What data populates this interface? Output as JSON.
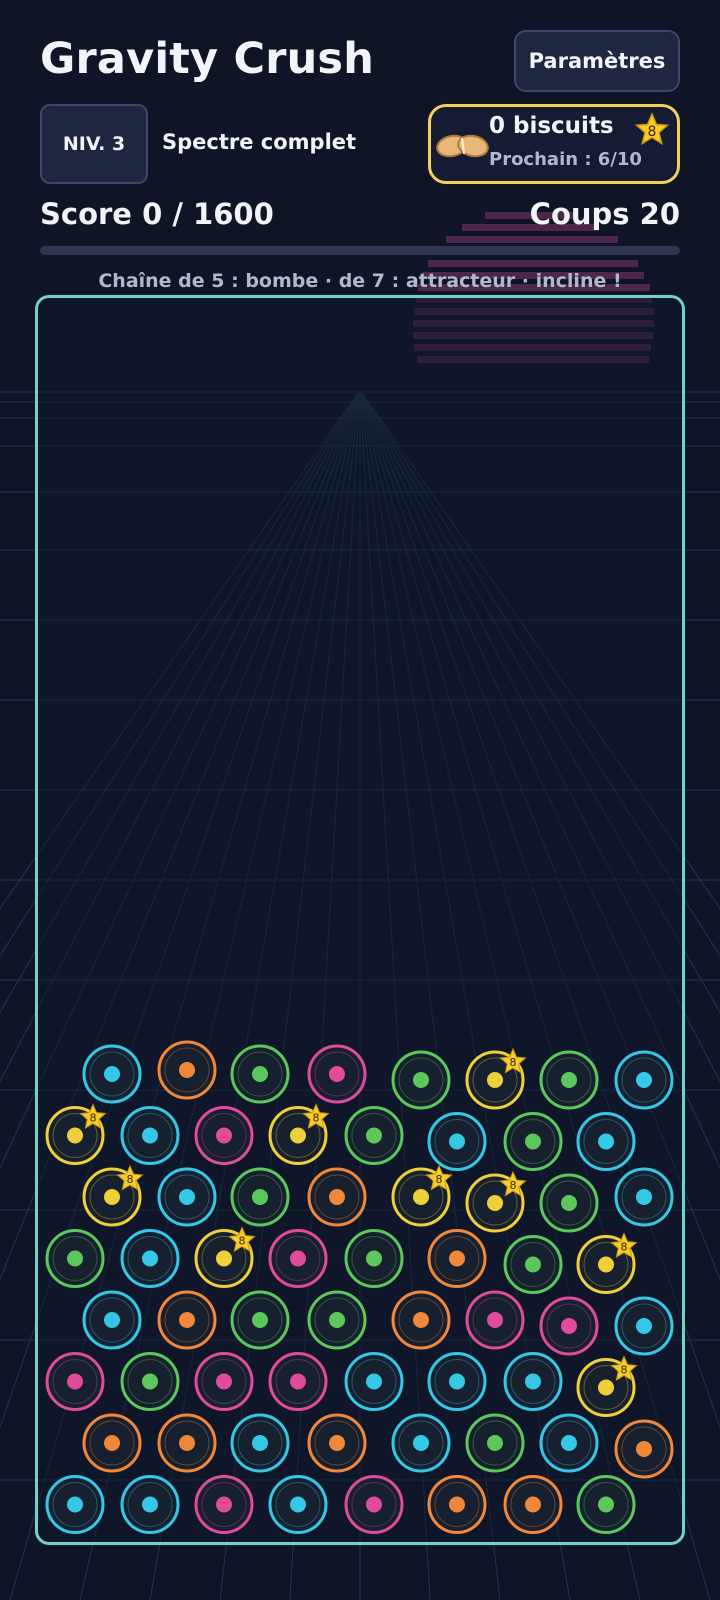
{
  "header": {
    "title": "Gravity Crush",
    "settings_label": "Paramètres"
  },
  "level": {
    "badge": "NIV. 3",
    "name": "Spectre complet"
  },
  "biscuits": {
    "count_label": "0 biscuits",
    "next_label": "Prochain : 6/10",
    "star_value": "8"
  },
  "stats": {
    "score_label": "Score 0 / 1600",
    "moves_label": "Coups 20",
    "progress": 0
  },
  "hint": "Chaîne de 5 : bombe · de 7 : attracteur · incline !",
  "colors": {
    "cyan": "#35c8e6",
    "orange": "#f0883a",
    "green": "#5cc85c",
    "pink": "#e04c9a",
    "yellow": "#efcf3a",
    "board_border": "#6fd3c8",
    "background": "#0f1426"
  },
  "board": {
    "star_value": "8",
    "rows": [
      [
        "cyan",
        "orange",
        "green",
        "pink",
        "green",
        "yellow*",
        "green",
        "cyan"
      ],
      [
        "yellow*",
        "cyan",
        "pink",
        "yellow*",
        "green",
        "cyan",
        "green",
        "cyan"
      ],
      [
        "yellow*",
        "cyan",
        "green",
        "orange",
        "yellow*",
        "yellow*",
        "green",
        "cyan"
      ],
      [
        "green",
        "cyan",
        "yellow*",
        "pink",
        "green",
        "orange",
        "green",
        "yellow*"
      ],
      [
        "cyan",
        "orange",
        "green",
        "green",
        "orange",
        "pink",
        "pink",
        "cyan"
      ],
      [
        "pink",
        "green",
        "pink",
        "pink",
        "cyan",
        "cyan",
        "cyan",
        "yellow*"
      ],
      [
        "orange",
        "orange",
        "cyan",
        "orange",
        "cyan",
        "green",
        "cyan",
        "orange"
      ],
      [
        "cyan",
        "cyan",
        "pink",
        "cyan",
        "pink",
        "orange",
        "orange",
        "green"
      ]
    ]
  }
}
